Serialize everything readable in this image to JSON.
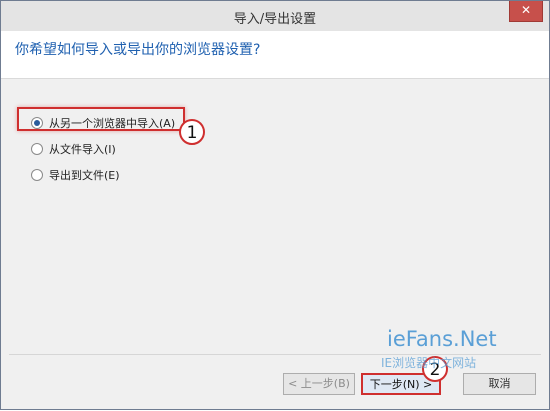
{
  "window": {
    "title": "导入/导出设置",
    "close_glyph": "✕"
  },
  "header": {
    "question": "你希望如何导入或导出你的浏览器设置?"
  },
  "options": [
    {
      "label": "从另一个浏览器中导入(A)",
      "checked": true
    },
    {
      "label": "从文件导入(I)",
      "checked": false
    },
    {
      "label": "导出到文件(E)",
      "checked": false
    }
  ],
  "annotations": {
    "marker1": "1",
    "marker2": "2"
  },
  "buttons": {
    "prev": "< 上一步(B)",
    "next": "下一步(N) >",
    "cancel": "取消"
  },
  "watermark": {
    "brand": "ieFans.Net",
    "subtitle": "IE浏览器中文网站"
  },
  "colors": {
    "accent": "#2061b0",
    "annotation_red": "#cf2f2f",
    "close_red": "#c7504b"
  }
}
